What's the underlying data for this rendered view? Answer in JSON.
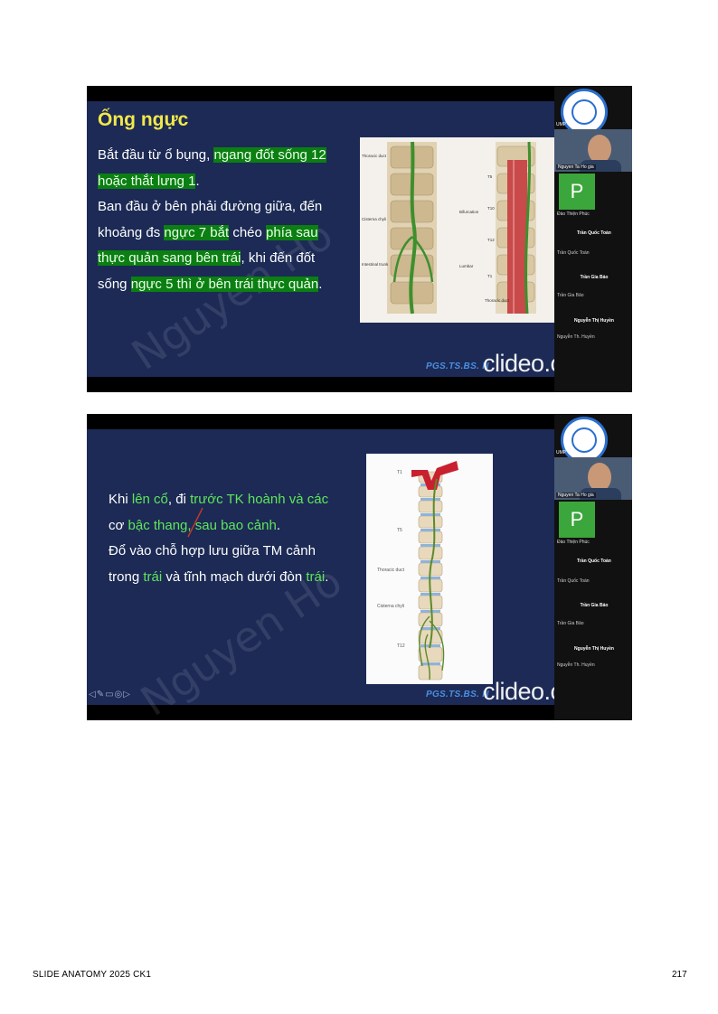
{
  "slide1": {
    "title": "Ống ngực",
    "lines": [
      [
        "Bắt đầu từ ổ bụng, ",
        "ngang đốt sống 12",
        ""
      ],
      [
        "",
        "hoặc thắt lưng 1",
        "."
      ],
      [
        "Ban đầu ở bên phải đường giữa, đến",
        "",
        ""
      ],
      [
        "khoảng đs ",
        "ngực 7 bắt",
        " chéo "
      ],
      [
        "",
        "thực quản sang bên trái",
        ", khi đến đốt"
      ],
      [
        "sống ",
        "ngực 5 thì ở bên trái thực quản",
        "."
      ]
    ],
    "line4_extra": "phía sau",
    "figure_labels": {
      "thoracic_duct": "Thoracic duct",
      "cisterna_chyli": "Cisterna chyli",
      "intestinal_trunk": "Intestinal trunk",
      "bifurcation": "Bifurcation",
      "lumbar": "Lumbar",
      "t5": "T5",
      "t10": "T10",
      "t12": "T12",
      "t1": "T1",
      "thoracic_duct2": "Thoracic duct"
    }
  },
  "slide2": {
    "line1_a": "Khi ",
    "line1_b": "lên cổ",
    "line1_c": ", đi ",
    "line1_d": "trước TK hoành và các",
    "line2_a": "cơ ",
    "line2_b": "bậc thang, sau bao cảnh",
    "line2_c": ".",
    "line3": "Đổ vào chỗ hợp lưu giữa TM cảnh",
    "line4_a": "trong ",
    "line4_b": "trái",
    "line4_c": " và tĩnh mạch dưới đòn ",
    "line4_d": "trái",
    "line4_e": ".",
    "figure_labels": {
      "t1": "T1",
      "t5": "T5",
      "thoracic_duct": "Thoracic duct",
      "cisterna_chyli": "Cisterna chyli",
      "t12": "T12"
    }
  },
  "common": {
    "credit": "PGS.TS.BS. N",
    "clideo": "clideo.com",
    "watermark": "Nguyen Ho",
    "cam_label": "Nguyen Ta Ho gia",
    "tile_letter": "P",
    "tile_sub": "Đào Thiện Phúc",
    "participants": [
      {
        "name": "Trần Quốc Toàn",
        "sub": "Trần Quốc Toàn"
      },
      {
        "name": "Trần Gia Bảo",
        "sub": "Trần Gia Bảo"
      },
      {
        "name": "Nguyễn Thị Huyền",
        "sub": "Nguyễn Th. Huyền"
      }
    ],
    "side_label": "UMP Ca"
  },
  "footer": {
    "left": "SLIDE ANATOMY 2025 CK1",
    "page": "217"
  },
  "colors": {
    "slide_bg": "#1c2a55",
    "title": "#f2e84a",
    "highlight": "#0b7f12",
    "green_text": "#5fe65a"
  }
}
